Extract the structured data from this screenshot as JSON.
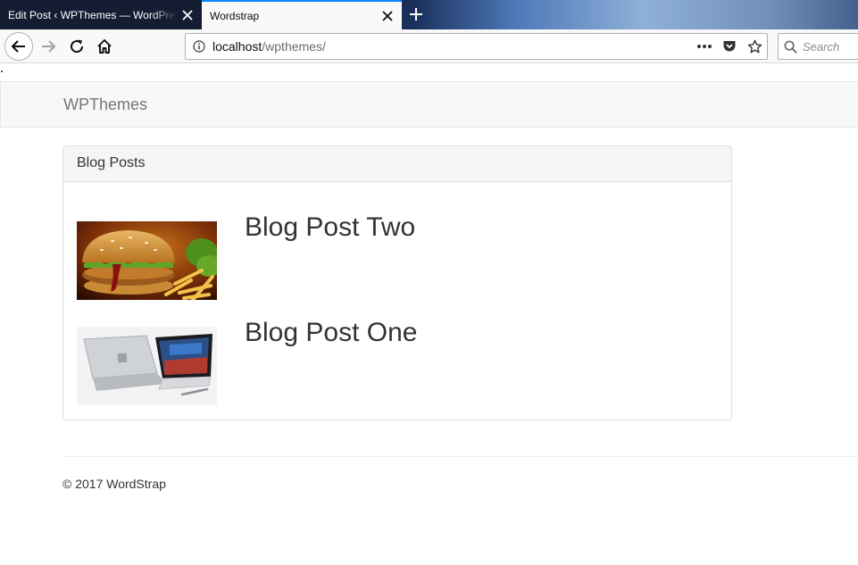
{
  "browser": {
    "tabs": [
      {
        "title": "Edit Post ‹ WPThemes — WordPress",
        "active": false
      },
      {
        "title": "Wordstrap",
        "active": true
      }
    ],
    "url": {
      "host": "localhost",
      "path": "/wpthemes/"
    },
    "search_placeholder": "Search"
  },
  "site": {
    "brand": "WPThemes",
    "panel_heading": "Blog Posts",
    "posts": [
      {
        "title": "Blog Post Two",
        "image": "burger-and-fries-photo"
      },
      {
        "title": "Blog Post One",
        "image": "laptop-photo"
      }
    ],
    "footer": "© 2017 WordStrap"
  },
  "colors": {
    "tab_accent": "#0a84ff",
    "navbar_bg": "#f8f8f8",
    "brand_text": "#777777",
    "panel_heading_bg": "#f5f5f5"
  }
}
